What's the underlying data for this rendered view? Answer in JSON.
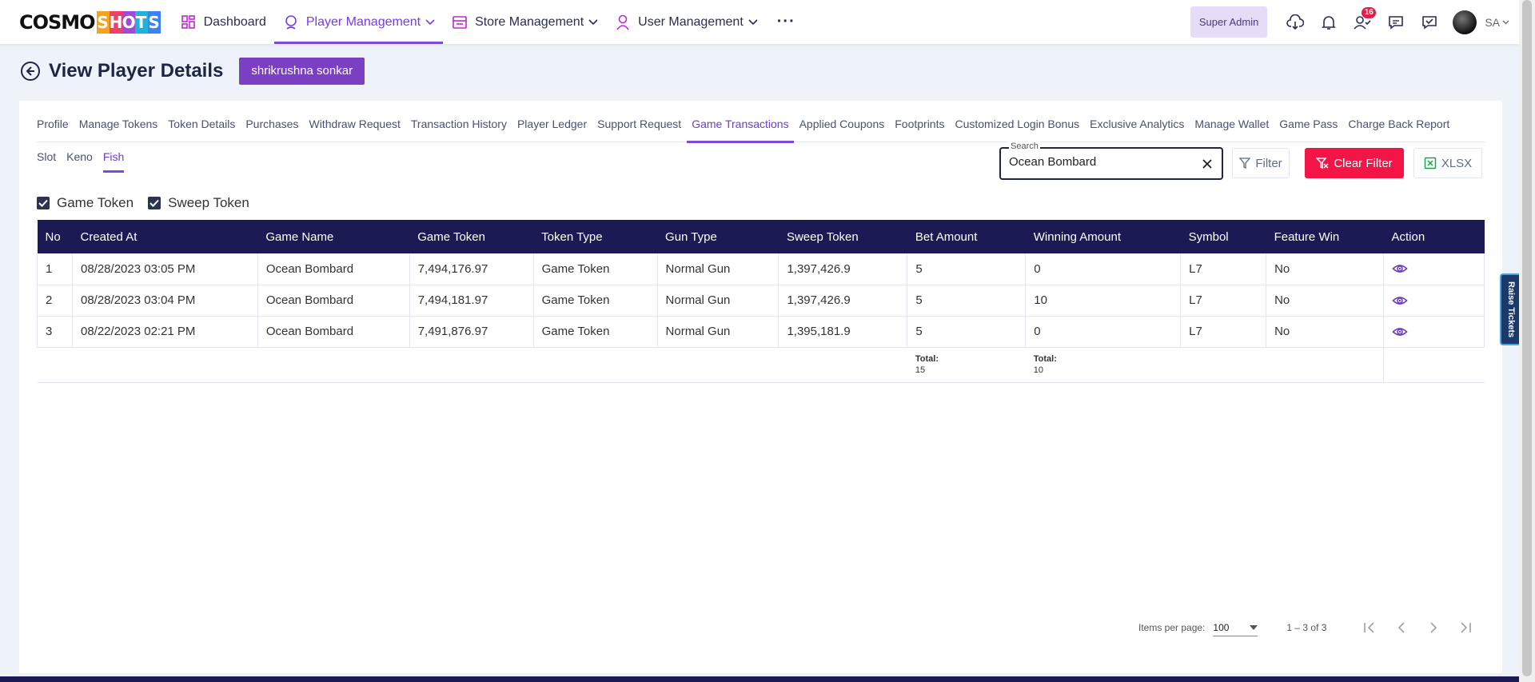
{
  "header": {
    "logo_left": "COSMO",
    "logo_right_letters": [
      "S",
      "H",
      "O",
      "T",
      "S"
    ],
    "logo_colors": [
      "#f7a21b",
      "#ef3f6a",
      "#9f4bd8",
      "#1fb3d7",
      "#3b82f6"
    ],
    "nav": [
      {
        "label": "Dashboard",
        "icon": "dashboard-icon"
      },
      {
        "label": "Player Management",
        "icon": "user-circle-icon",
        "active": true
      },
      {
        "label": "Store Management",
        "icon": "store-icon"
      },
      {
        "label": "User Management",
        "icon": "person-icon"
      }
    ],
    "more": "···",
    "role": "Super Admin",
    "notification_count": "16",
    "avatar_initials": "SA"
  },
  "page": {
    "title": "View Player Details",
    "player_name": "shrikrushna sonkar"
  },
  "tabs": [
    "Profile",
    "Manage Tokens",
    "Token Details",
    "Purchases",
    "Withdraw Request",
    "Transaction History",
    "Player Ledger",
    "Support Request",
    "Game Transactions",
    "Applied Coupons",
    "Footprints",
    "Customized Login Bonus",
    "Exclusive Analytics",
    "Manage Wallet",
    "Game Pass",
    "Charge Back Report"
  ],
  "active_tab": "Game Transactions",
  "subtabs": [
    "Slot",
    "Keno",
    "Fish"
  ],
  "active_subtab": "Fish",
  "search": {
    "label": "Search",
    "value": "Ocean Bombard"
  },
  "buttons": {
    "filter": "Filter",
    "clear_filter": "Clear Filter",
    "xlsx": "XLSX"
  },
  "checkboxes": [
    {
      "label": "Game Token",
      "checked": true
    },
    {
      "label": "Sweep Token",
      "checked": true
    }
  ],
  "table": {
    "headers": [
      "No",
      "Created At",
      "Game Name",
      "Game Token",
      "Token Type",
      "Gun Type",
      "Sweep Token",
      "Bet Amount",
      "Winning Amount",
      "Symbol",
      "Feature Win",
      "Action"
    ],
    "rows": [
      [
        "1",
        "08/28/2023 03:05 PM",
        "Ocean Bombard",
        "7,494,176.97",
        "Game Token",
        "Normal Gun",
        "1,397,426.9",
        "5",
        "0",
        "L7",
        "No"
      ],
      [
        "2",
        "08/28/2023 03:04 PM",
        "Ocean Bombard",
        "7,494,181.97",
        "Game Token",
        "Normal Gun",
        "1,397,426.9",
        "5",
        "10",
        "L7",
        "No"
      ],
      [
        "3",
        "08/22/2023 02:21 PM",
        "Ocean Bombard",
        "7,491,876.97",
        "Game Token",
        "Normal Gun",
        "1,395,181.9",
        "5",
        "0",
        "L7",
        "No"
      ]
    ],
    "totals": {
      "label": "Total:",
      "bet": "15",
      "winning": "10"
    }
  },
  "paginator": {
    "label": "Items per page:",
    "page_size": "100",
    "range": "1 – 3 of 3"
  },
  "raise_tickets": "Raise Tickets",
  "colors": {
    "accent": "#7b4bd6",
    "header_bg": "#1b1a54",
    "danger": "#f31545"
  }
}
